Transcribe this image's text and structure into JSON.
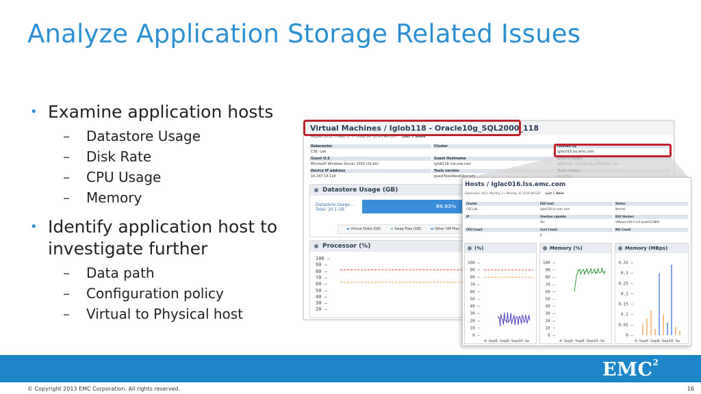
{
  "slide": {
    "title": "Analyze Application Storage Related Issues",
    "bullets": [
      {
        "text": "Examine application hosts",
        "subs": [
          "Datastore Usage",
          "Disk Rate",
          "CPU Usage",
          "Memory"
        ]
      },
      {
        "text": "Identify application host to investigate further",
        "subs": [
          "Data path",
          "Configuration policy",
          "Virtual to Physical host"
        ]
      }
    ],
    "footer": {
      "copyright": "© Copyright 2013 EMC Corporation. All rights reserved.",
      "page": "16",
      "logo": "EMC",
      "logo_sup": "2"
    }
  },
  "vm_window": {
    "title": "Virtual Machines / Iglob118 - Oracle10g_SQL2000_118",
    "date_range": "August 2012, Friday 17 » Friday 24, 12:45 AM EDT",
    "range_label": "Last 1 Week",
    "fields": [
      {
        "label": "Datacenter",
        "value": "CSE- Lab"
      },
      {
        "label": "Cluster",
        "value": ""
      },
      {
        "label": "Hosted by",
        "value": "iglac016.lss.emc.com"
      },
      {
        "label": "Guest O.S",
        "value": "Microsoft Windows Server 2003 (32-bit)"
      },
      {
        "label": "Guest Hostname",
        "value": "iglob118.cse.cse.com"
      },
      {
        "label": "Device Name",
        "value": "Iglob118 - Oracle10g_SQL2000_118"
      },
      {
        "label": "Device IP address",
        "value": "10.247.14.118"
      },
      {
        "label": "Tools version",
        "value": "guestToolsNeedUpgrade"
      },
      {
        "label": "Tools status",
        "value": "Running"
      }
    ],
    "datastore": {
      "title": "Datastore Usage (GB)",
      "summary": "Datastore Usage... Total: 20.1 GB",
      "percent_label": "89.93%",
      "percent": 89.93,
      "legend": [
        "Virtual Disks (GB)",
        "Swap Files (GB)",
        "Other VM Files"
      ],
      "colors": [
        "#3a8dd8",
        "#8fc8f2",
        "#d6e6f4"
      ]
    },
    "processor": {
      "title": "Processor (%)",
      "ticks": [
        "100",
        "90",
        "80",
        "70",
        "60",
        "50",
        "40",
        "30",
        "20"
      ]
    }
  },
  "host_window": {
    "title": "Hosts / Iglac016.lss.emc.com",
    "date_range": "September 2012, Monday 3 » Monday 10, 6:00 AM EDT",
    "range_label": "Last 1 Week",
    "fields": [
      {
        "label": "Cluster",
        "value": "CSE Lab"
      },
      {
        "label": "ESX host",
        "value": "iglac016.lss.emc.com"
      },
      {
        "label": "Status",
        "value": "Normal"
      },
      {
        "label": "IP",
        "value": ""
      },
      {
        "label": "Vmotion capable",
        "value": "Yes"
      },
      {
        "label": "ESX Version",
        "value": "VMware ESX 5.0.0 build-623860"
      },
      {
        "label": "CPU Count",
        "value": ""
      },
      {
        "label": "Core Count",
        "value": "8"
      },
      {
        "label": "NIC Count",
        "value": ""
      }
    ],
    "charts": [
      {
        "title": "(%)",
        "ticks": [
          "100",
          "90",
          "80",
          "70",
          "60",
          "50",
          "40",
          "30",
          "20",
          "10",
          "0"
        ],
        "xlabels": "4-Sep6-Sep8-Sep10-Se"
      },
      {
        "title": "Memory (%)",
        "ticks": [
          "100",
          "90",
          "80",
          "70",
          "60",
          "50",
          "40",
          "30",
          "20",
          "10",
          "0"
        ],
        "xlabels": "4-Sep6-Sep8-Sep10-Se"
      },
      {
        "title": "Memory (MBps)",
        "ticks": [
          "0.35",
          "0.3",
          "0.25",
          "0.2",
          "0.15",
          "0.1",
          "0.05",
          "0"
        ],
        "xlabels": "4-Sep6-Sep8-Sep10-Se"
      }
    ]
  },
  "colors": {
    "accent": "#2c8fd1",
    "footer": "#1d86c8",
    "highlight": "#c0212a",
    "threshold_red": "#e64a3f",
    "threshold_orange": "#f0a04a"
  }
}
